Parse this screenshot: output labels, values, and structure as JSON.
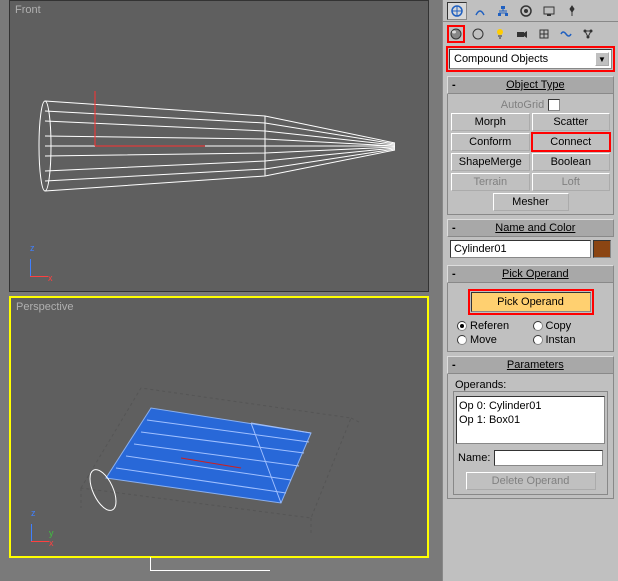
{
  "viewports": {
    "front_label": "Front",
    "perspective_label": "Perspective"
  },
  "category_dropdown": "Compound Objects",
  "rollouts": {
    "object_type": {
      "title": "Object Type",
      "autogrid_label": "AutoGrid",
      "buttons": [
        "Morph",
        "Scatter",
        "Conform",
        "Connect",
        "ShapeMerge",
        "Boolean",
        "Terrain",
        "Loft",
        "Mesher"
      ]
    },
    "name_color": {
      "title": "Name and Color",
      "object_name": "Cylinder01"
    },
    "pick_operand": {
      "title": "Pick Operand",
      "button_label": "Pick Operand",
      "radios": [
        "Referen",
        "Copy",
        "Move",
        "Instan"
      ]
    },
    "parameters": {
      "title": "Parameters",
      "operands_label": "Operands:",
      "operands": [
        "Op 0: Cylinder01",
        "Op 1: Box01"
      ],
      "name_label": "Name:",
      "delete_label": "Delete Operand"
    }
  }
}
